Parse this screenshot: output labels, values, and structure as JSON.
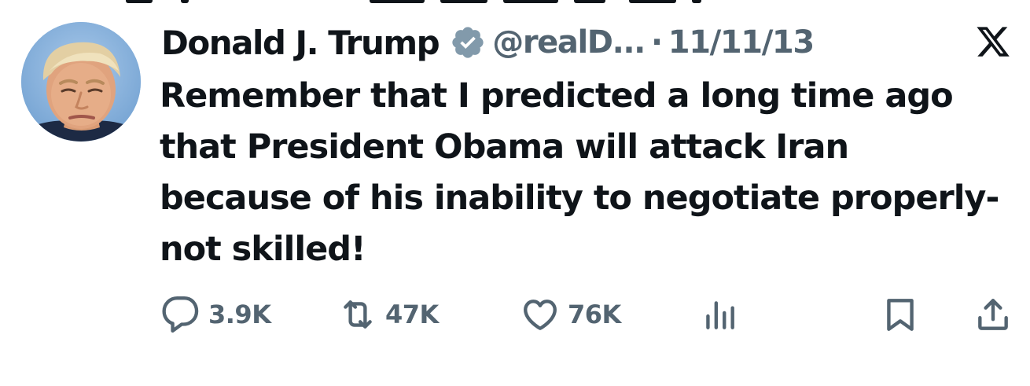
{
  "author": {
    "name": "Donald J. Trump",
    "handle": "@realD...",
    "separator": "·",
    "date": "11/11/13",
    "avatar_icon": "avatar-photo",
    "verified_icon": "verified-badge-icon"
  },
  "brand": {
    "logo_icon": "x-logo-icon"
  },
  "tweet": {
    "text": "Remember that I predicted a long time ago that President Obama will attack Iran because of his inability to negotiate properly-not skilled!"
  },
  "actions": {
    "replies": {
      "icon": "reply-icon",
      "count": "3.9K"
    },
    "reposts": {
      "icon": "repost-icon",
      "count": "47K"
    },
    "likes": {
      "icon": "heart-icon",
      "count": "76K"
    },
    "views": {
      "icon": "analytics-icon"
    },
    "bookmark": {
      "icon": "bookmark-icon"
    },
    "share": {
      "icon": "share-icon"
    }
  },
  "colors": {
    "text_primary": "#0f1419",
    "text_secondary": "#536471",
    "verified_badge": "#829aab",
    "background": "#ffffff"
  }
}
